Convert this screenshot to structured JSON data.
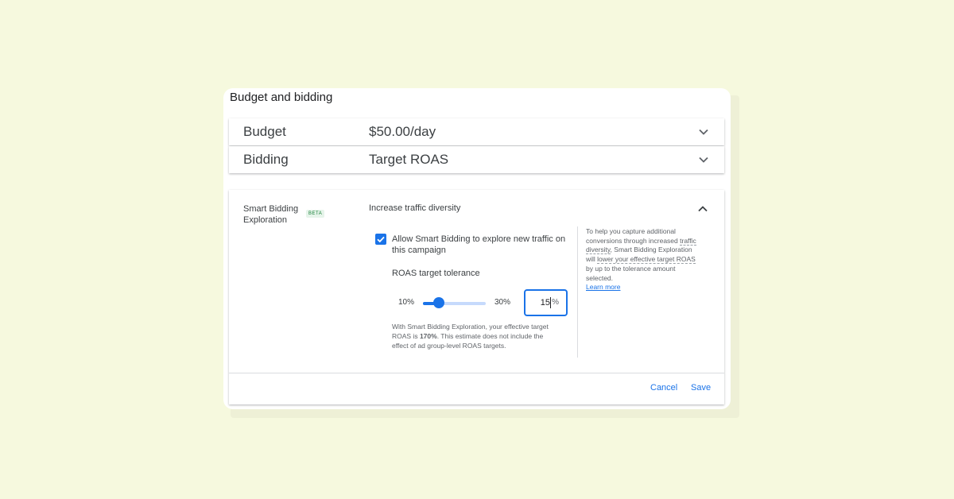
{
  "card": {
    "title": "Budget and bidding"
  },
  "budget": {
    "label": "Budget",
    "value": "$50.00/day"
  },
  "bidding": {
    "label": "Bidding",
    "value": "Target ROAS"
  },
  "exploration": {
    "label": "Smart Bidding Exploration",
    "badge": "BETA",
    "title": "Increase traffic diversity",
    "checkbox_checked": true,
    "checkbox_label": "Allow Smart Bidding to explore new traffic on this campaign",
    "tolerance": {
      "title": "ROAS target tolerance",
      "min_label": "10%",
      "max_label": "30%",
      "min": 10,
      "max": 30,
      "value": 15,
      "unit": "%"
    },
    "estimate": {
      "prefix": "With Smart Bidding Exploration, your effective target ROAS is ",
      "value": "170%",
      "suffix": ". This estimate does not include the effect of ad group-level ROAS targets."
    },
    "help": {
      "part1": "To help you capture additional conversions through increased ",
      "link1": "traffic diversity",
      "part2": ", Smart Bidding Exploration will ",
      "link2": "lower your effective target ROAS",
      "part3": " by up to the tolerance amount selected.",
      "learn_more": "Learn more"
    }
  },
  "actions": {
    "cancel": "Cancel",
    "save": "Save"
  },
  "colors": {
    "background": "#f6f9de",
    "accent": "#1a73e8",
    "text": "#3c4043",
    "badge_text": "#188038",
    "badge_bg": "#e6f4ea"
  }
}
